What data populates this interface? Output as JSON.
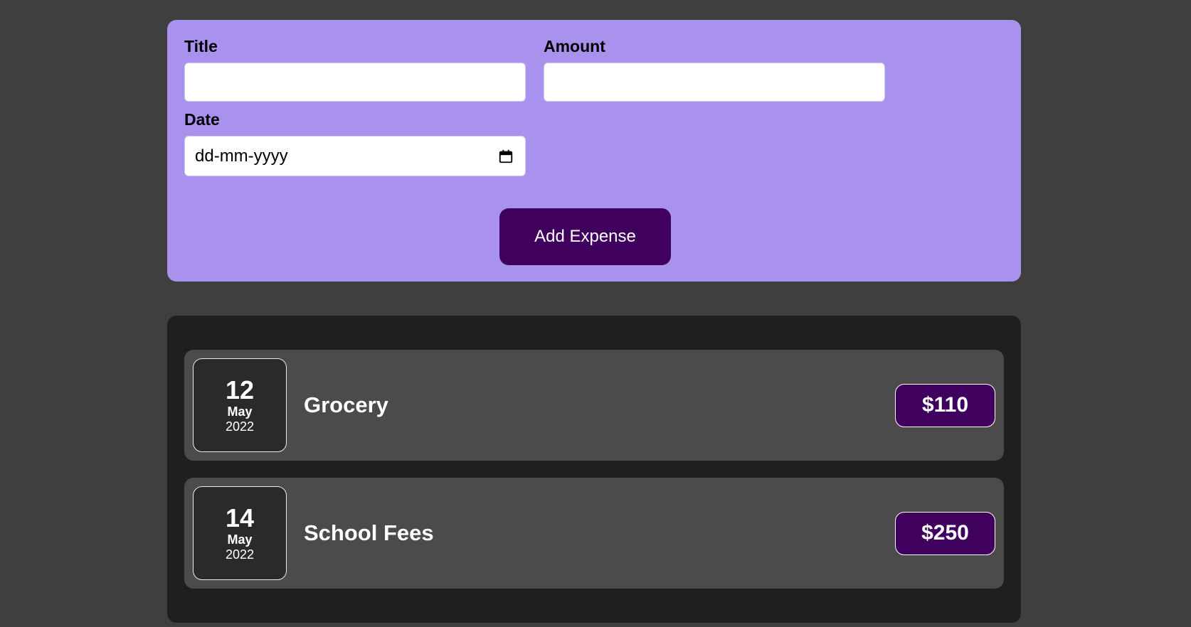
{
  "form": {
    "title_label": "Title",
    "title_value": "",
    "amount_label": "Amount",
    "amount_value": "",
    "date_label": "Date",
    "date_placeholder": "dd-mm-yyyy",
    "submit_label": "Add Expense"
  },
  "expenses": [
    {
      "day": "12",
      "month": "May",
      "year": "2022",
      "title": "Grocery",
      "amount": "$110"
    },
    {
      "day": "14",
      "month": "May",
      "year": "2022",
      "title": "School Fees",
      "amount": "$250"
    }
  ],
  "colors": {
    "background": "#3f3f3f",
    "form_card": "#a892ee",
    "list_card": "#1f1f1f",
    "item": "#4b4b4b",
    "accent": "#40005d"
  },
  "icons": {
    "date_picker": "calendar-icon"
  }
}
